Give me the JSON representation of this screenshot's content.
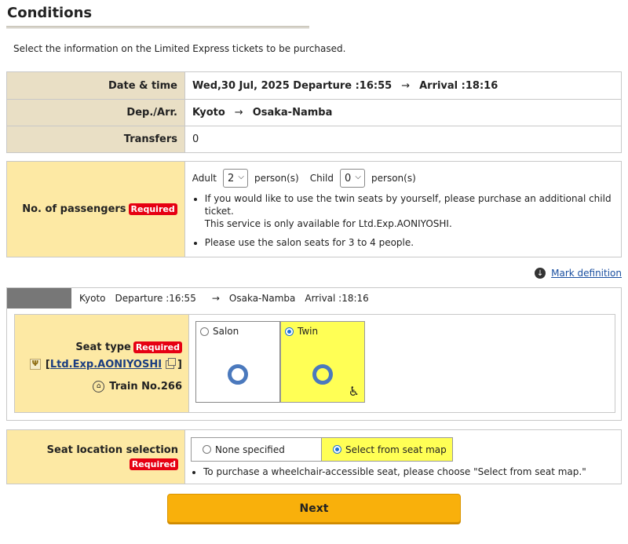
{
  "page": {
    "title": "Conditions",
    "intro": "Select the information on the Limited Express tickets to be purchased."
  },
  "info": {
    "date_label": "Date & time",
    "date_value": "Wed,30 Jul, 2025 Departure :16:55",
    "arrival_value": "Arrival :18:16",
    "arrow": "→",
    "deparr_label": "Dep./Arr.",
    "dep_station": "Kyoto",
    "arr_station": "Osaka-Namba",
    "transfers_label": "Transfers",
    "transfers_value": "0"
  },
  "passengers": {
    "label": "No. of passengers",
    "required": "Required",
    "adult_label": "Adult",
    "adult_value": "2",
    "adult_unit": "person(s)",
    "child_label": "Child",
    "child_value": "0",
    "child_unit": "person(s)",
    "note1_line1": "If you would like to use the twin seats by yourself, please purchase an additional child ticket.",
    "note1_line2": "This service is only available for Ltd.Exp.AONIYOSHI.",
    "note2": "Please use the salon seats for 3 to 4 people."
  },
  "mark_definition": "Mark definition",
  "train": {
    "from": "Kyoto",
    "departure": "Departure :16:55",
    "arrow": "→",
    "to": "Osaka-Namba",
    "arrival": "Arrival :18:16",
    "seat_type_label": "Seat type",
    "required": "Required",
    "bracket_open": "[",
    "name": "Ltd.Exp.AONIYOSHI",
    "bracket_close": "]",
    "train_no": "Train No.266",
    "options": [
      {
        "label": "Salon",
        "selected": false
      },
      {
        "label": "Twin",
        "selected": true
      }
    ]
  },
  "location": {
    "label": "Seat location selection",
    "required": "Required",
    "option_none": "None specified",
    "option_map": "Select from seat map",
    "note": "To purchase a wheelchair-accessible seat, please choose \"Select from seat map.\""
  },
  "next_label": "Next",
  "colors": {
    "label_beige": "#e9dfc5",
    "label_yellow": "#fde9a4",
    "selected_yellow": "#ffff55",
    "required_red": "#e60012",
    "next_orange": "#f9b00b"
  }
}
